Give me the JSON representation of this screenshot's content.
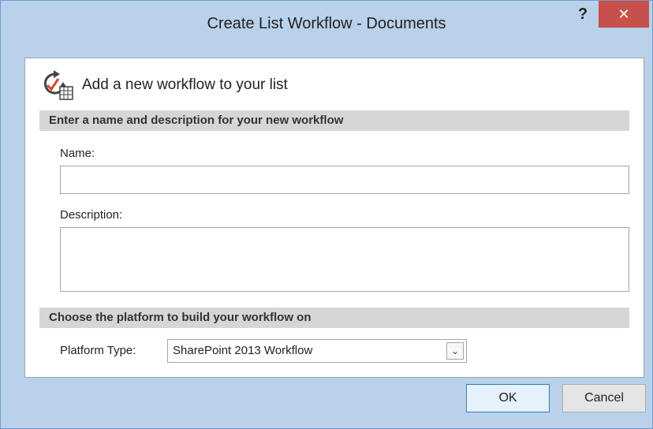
{
  "window": {
    "title": "Create List Workflow - Documents",
    "help_label": "?",
    "close_label": "✕",
    "close_color": "#c7504b"
  },
  "dialog": {
    "heading": "Add a new workflow to your list",
    "heading_icon": "workflow-list-icon",
    "section_name": {
      "title": "Enter a name and description for your new workflow",
      "name_label": "Name:",
      "name_value": "",
      "description_label": "Description:",
      "description_value": ""
    },
    "section_platform": {
      "title": "Choose the platform to build your workflow on",
      "platform_label": "Platform Type:",
      "platform_value": "SharePoint 2013 Workflow",
      "dropdown_icon": "chevron-down-icon"
    }
  },
  "buttons": {
    "ok_label": "OK",
    "cancel_label": "Cancel"
  }
}
